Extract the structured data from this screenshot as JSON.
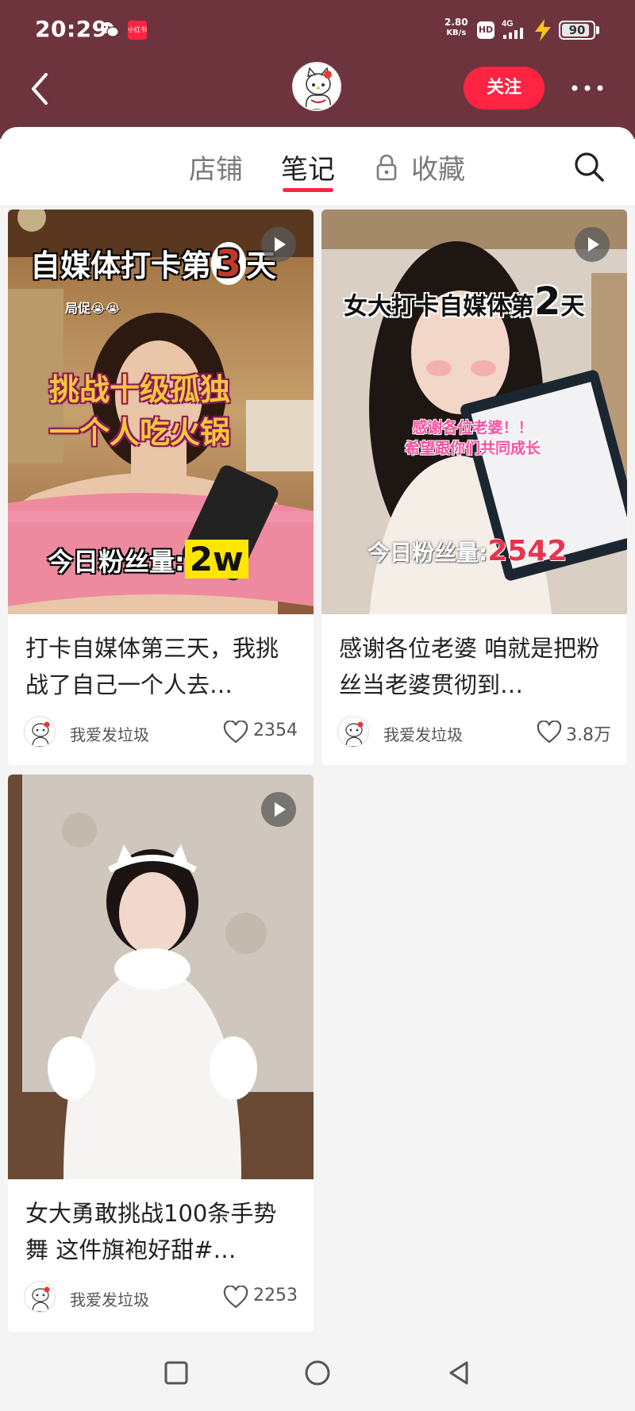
{
  "status_bar": {
    "time": "20:29",
    "net_speed_value": "2.80",
    "net_speed_unit": "KB/s",
    "hd": "HD",
    "network": "4G",
    "battery": "90",
    "battery_level_percent": 90,
    "app_badge": "小红书"
  },
  "header": {
    "follow_label": "关注"
  },
  "tabs": [
    {
      "label": "店铺",
      "active": false
    },
    {
      "label": "笔记",
      "active": true
    },
    {
      "label": "收藏",
      "active": false,
      "locked": true
    }
  ],
  "notes": [
    {
      "title": "打卡自媒体第三天，我挑战了自己一个人去…",
      "author": "我爱发垃圾",
      "likes": "2354",
      "is_video": true,
      "overlay": {
        "title_prefix": "自媒体打卡第",
        "title_num": "3",
        "title_suffix": "天",
        "sub": "局促😭😭",
        "line1": "挑战十级孤独",
        "line2": "一个人吃火锅",
        "fans_label": "今日粉丝量:",
        "fans_value": "2w"
      }
    },
    {
      "title": "感谢各位老婆 咱就是把粉丝当老婆贯彻到…",
      "author": "我爱发垃圾",
      "likes": "3.8万",
      "is_video": true,
      "overlay": {
        "title_prefix": "女大打卡自媒体第",
        "title_num": "2",
        "title_suffix": "天",
        "line1": "感谢各位老婆！！",
        "line2": "希望跟你们共同成长",
        "fans_label": "今日粉丝量:",
        "fans_value": "2542"
      }
    },
    {
      "title": "女大勇敢挑战100条手势舞 这件旗袍好甜#…",
      "author": "我爱发垃圾",
      "likes": "2253",
      "is_video": true
    }
  ],
  "colors": {
    "header_bg": "#6e343d",
    "accent": "#ff2442"
  }
}
